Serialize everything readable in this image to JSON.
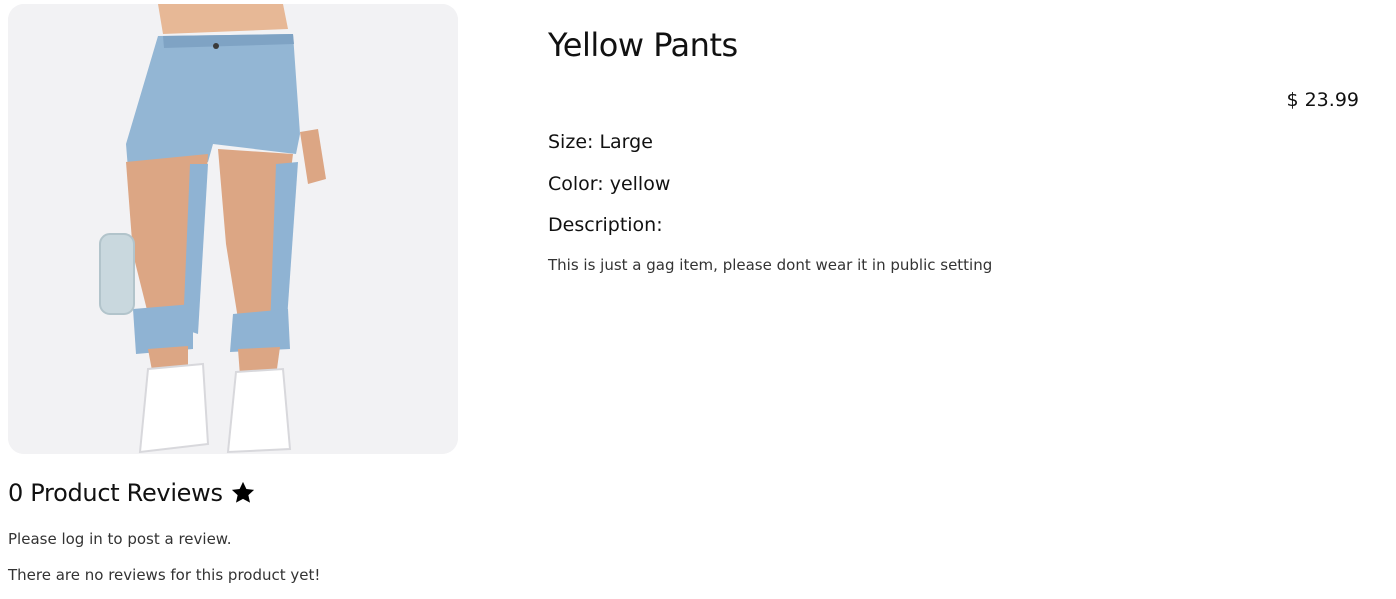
{
  "product": {
    "title": "Yellow Pants",
    "price": "$ 23.99",
    "size_text": "Size: Large",
    "color_text": "Color: yellow",
    "description_label": "Description:",
    "description": "This is just a gag item, please dont wear it in public setting",
    "image_icon": "product-photo"
  },
  "reviews": {
    "heading": "0 Product Reviews",
    "star_icon": "star-icon",
    "login_note": "Please log in to post a review.",
    "empty_note": "There are no reviews for this product yet!"
  },
  "colors": {
    "text": "#111111",
    "denim": "#8fb3d3",
    "image_background": "#f1f1f3"
  }
}
